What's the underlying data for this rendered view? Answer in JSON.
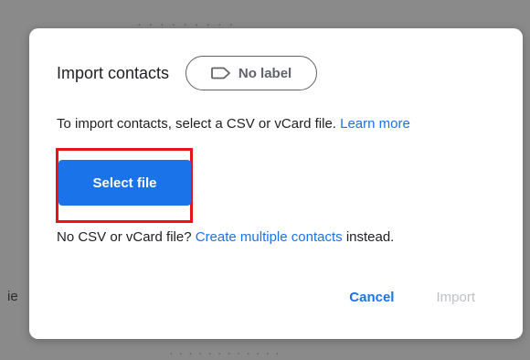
{
  "background": {
    "top_text": "· · · ·  · · ·  ·  ·",
    "left_text": "ie",
    "bottom_text": "· · · · · ·  · · · ·  · ·"
  },
  "dialog": {
    "title": "Import contacts",
    "label_chip": {
      "icon": "label-icon",
      "text": "No label"
    },
    "description": "To import contacts, select a CSV or vCard file.",
    "learn_more": "Learn more",
    "select_file_label": "Select file",
    "alt_prefix": "No CSV or vCard file?",
    "alt_link": "Create multiple contacts",
    "alt_suffix": "instead.",
    "cancel_label": "Cancel",
    "import_label": "Import"
  },
  "colors": {
    "accent": "#1a73e8",
    "highlight": "#e8141a",
    "disabled_text": "#bdc1c6"
  }
}
